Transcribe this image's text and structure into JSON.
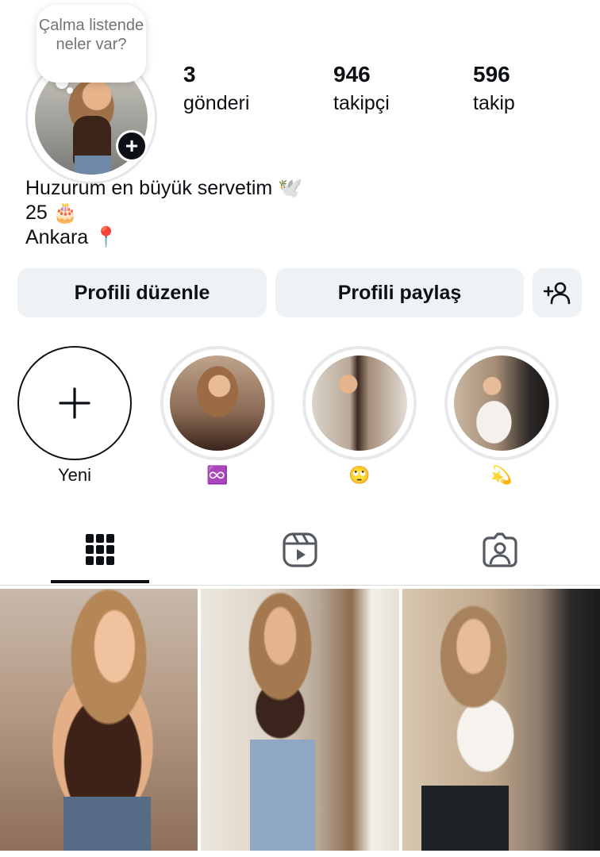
{
  "note": {
    "text": "Çalma listende neler var?"
  },
  "stats": {
    "posts": {
      "count": "3",
      "label": "gönderi"
    },
    "followers": {
      "count": "946",
      "label": "takipçi"
    },
    "following": {
      "count": "596",
      "label": "takip"
    }
  },
  "bio": {
    "line1": "Huzurum en büyük servetim 🕊️",
    "line2": "25 🎂",
    "line3": "Ankara 📍"
  },
  "actions": {
    "edit_profile": "Profili düzenle",
    "share_profile": "Profili paylaş"
  },
  "highlights": [
    {
      "label": "Yeni"
    },
    {
      "label": "♾️"
    },
    {
      "label": "🙄"
    },
    {
      "label": "💫"
    }
  ],
  "tabs": {
    "active": "posts",
    "items": [
      "grid-icon",
      "reels-icon",
      "tagged-icon"
    ]
  },
  "colors": {
    "text": "#0c1014",
    "button_bg": "#eff2f5",
    "muted": "#737373"
  }
}
